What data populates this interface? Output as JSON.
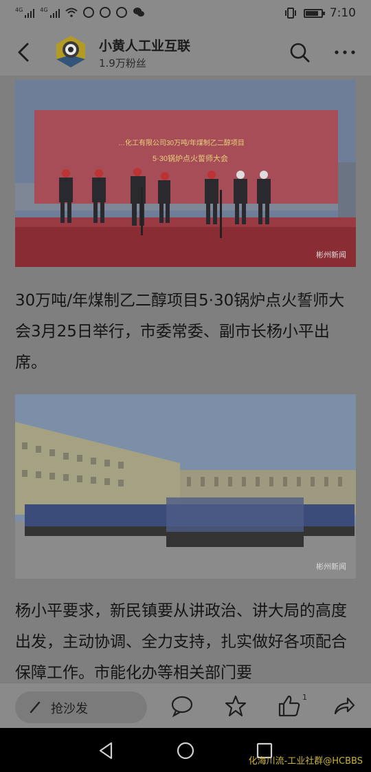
{
  "status_bar": {
    "network1": "4G",
    "network2": "4G",
    "time": "7:10",
    "battery_level": 0.8
  },
  "header": {
    "account_name": "小黄人工业互联",
    "followers": "1.9万粉丝"
  },
  "article": {
    "photo1": {
      "banner_org": "…化工有限公司30万吨/年煤制乙二醇项目",
      "banner_event": "5·30锅炉点火誓师大会",
      "watermark": "彬州新闻"
    },
    "paragraph1": "30万吨/年煤制乙二醇项目5·30锅炉点火誓师大会3月25日举行，市委常委、副市长杨小平出席。",
    "photo2": {
      "watermark": "彬州新闻"
    },
    "paragraph2": "杨小平要求，新民镇要从讲政治、讲大局的高度出发，主动协调、全力支持，扎实做好各项配合保障工作。市能化办等相关部门要"
  },
  "action_bar": {
    "comment_placeholder": "抢沙发",
    "like_count": "1"
  },
  "watermark_overlay": "化海川流-工业社群@HCBBS"
}
